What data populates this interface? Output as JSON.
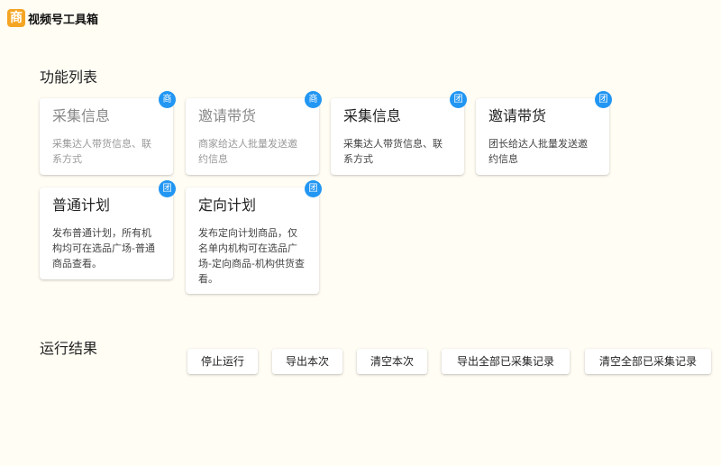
{
  "app": {
    "title": "视频号工具箱",
    "logo_char": "商",
    "logo_color": "#f5a524"
  },
  "sections": {
    "features_title": "功能列表",
    "results_title": "运行结果"
  },
  "badge_color": "#2196f3",
  "cards": [
    {
      "title": "采集信息",
      "desc": "采集达人带货信息、联系方式",
      "badge": "商",
      "disabled": true
    },
    {
      "title": "邀请带货",
      "desc": "商家给达人批量发送邀约信息",
      "badge": "商",
      "disabled": true
    },
    {
      "title": "采集信息",
      "desc": "采集达人带货信息、联系方式",
      "badge": "团",
      "disabled": false
    },
    {
      "title": "邀请带货",
      "desc": "团长给达人批量发送邀约信息",
      "badge": "团",
      "disabled": false
    },
    {
      "title": "普通计划",
      "desc": "发布普通计划，所有机构均可在选品广场-普通商品查看。",
      "badge": "团",
      "disabled": false
    },
    {
      "title": "定向计划",
      "desc": "发布定向计划商品，仅名单内机构可在选品广场-定向商品-机构供货查看。",
      "badge": "团",
      "disabled": false
    }
  ],
  "buttons": {
    "stop": "停止运行",
    "export_current": "导出本次",
    "clear_current": "清空本次",
    "export_all": "导出全部已采集记录",
    "clear_all": "清空全部已采集记录"
  }
}
